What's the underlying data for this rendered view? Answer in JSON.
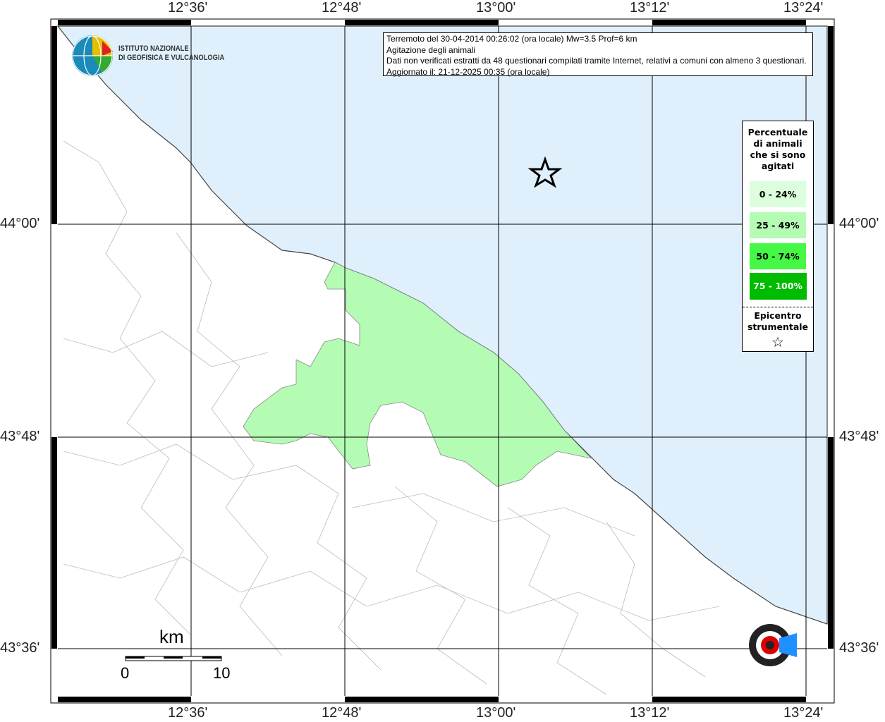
{
  "info": {
    "line1": "Terremoto del 30-04-2014 00:26:02 (ora locale) Mw=3.5 Prof=6 km",
    "line2": "Agitazione degli animali",
    "line3": "Dati non verificati estratti da 48 questionari compilati tramite Internet, relativi a comuni con almeno 3 questionari.",
    "line4": "Aggiornato il: 21-12-2025 00:35 (ora locale)"
  },
  "legend": {
    "title": [
      "Percentuale",
      "di animali",
      "che si sono",
      "agitati"
    ],
    "classes": [
      {
        "label": "0 - 24%",
        "color": "#dcfedc"
      },
      {
        "label": "25 - 49%",
        "color": "#b4fcb4"
      },
      {
        "label": "50 - 74%",
        "color": "#46f846"
      },
      {
        "label": "75 - 100%",
        "color": "#00bc00"
      }
    ],
    "epicentro": [
      "Epicentro",
      "strumentale"
    ]
  },
  "axes": {
    "lon": [
      "12°36'",
      "12°48'",
      "13°00'",
      "13°12'",
      "13°24'"
    ],
    "lat": [
      "44°00'",
      "43°48'",
      "43°36'"
    ]
  },
  "logo": {
    "line1": "ISTITUTO NAZIONALE",
    "line2": "DI GEOFISICA E VULCANOLOGIA"
  },
  "hsc_logo": "haisentitoilterremoto.it www",
  "scale": {
    "unit": "km",
    "min": "0",
    "max": "10"
  },
  "colors": {
    "sea": "#dff0fc",
    "affected": "#b4fcb4"
  }
}
